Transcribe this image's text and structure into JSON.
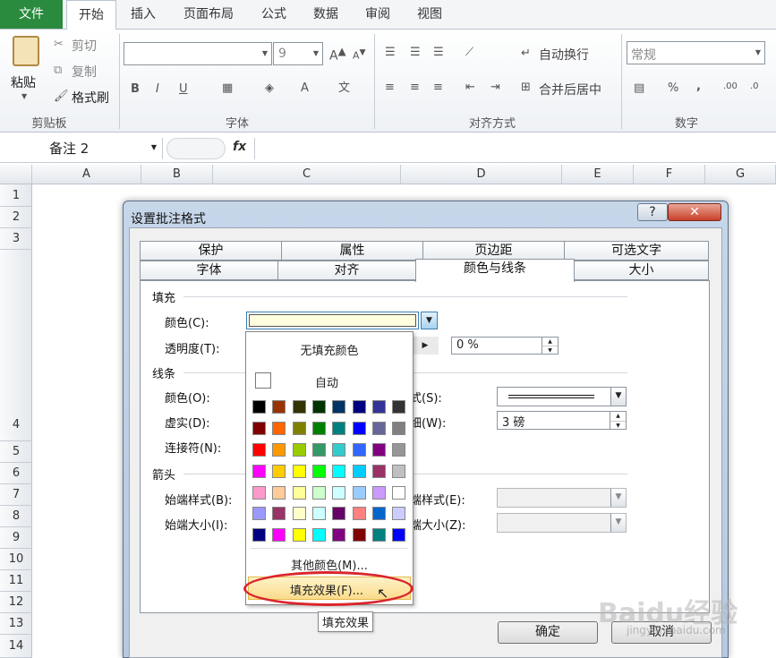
{
  "ribbon": {
    "tabs": [
      "文件",
      "开始",
      "插入",
      "页面布局",
      "公式",
      "数据",
      "审阅",
      "视图"
    ],
    "clipboard": {
      "paste": "粘贴",
      "cut": "剪切",
      "copy": "复制",
      "format_painter": "格式刷",
      "group": "剪贴板"
    },
    "font": {
      "name_value": "",
      "size_value": "9",
      "group": "字体"
    },
    "alignment": {
      "wrap": "自动换行",
      "merge": "合并后居中",
      "group": "对齐方式"
    },
    "number": {
      "format": "常规",
      "group": "数字",
      "percent": "%",
      "comma": ","
    }
  },
  "formula_bar": {
    "name_box": "备注 2",
    "fx": "fx",
    "formula": ""
  },
  "sheet": {
    "columns": [
      "A",
      "B",
      "C",
      "D",
      "E",
      "F",
      "G"
    ],
    "rows": [
      "1",
      "2",
      "3",
      "4",
      "5",
      "6",
      "7",
      "8",
      "9",
      "10",
      "11",
      "12",
      "13",
      "14"
    ]
  },
  "dialog": {
    "title": "设置批注格式",
    "help": "?",
    "close": "✕",
    "tabs_row1": [
      "保护",
      "属性",
      "页边距",
      "可选文字"
    ],
    "tabs_row2": [
      "字体",
      "对齐",
      "颜色与线条",
      "大小"
    ],
    "fill_section": "填充",
    "color_label": "颜色(C):",
    "transparency_label": "透明度(T):",
    "transparency_value": "0 %",
    "line_section": "线条",
    "line_color_label": "颜色(O):",
    "dash_label": "虚实(D):",
    "connector_label": "连接符(N):",
    "style_label": "式(S):",
    "weight_label": "细(W):",
    "weight_value": "3 磅",
    "arrow_section": "箭头",
    "begin_style_label": "始端样式(B):",
    "begin_size_label": "始端大小(I):",
    "end_style_label": "端样式(E):",
    "end_size_label": "端大小(Z):",
    "ok": "确定",
    "cancel": "取消"
  },
  "color_popup": {
    "no_fill": "无填充颜色",
    "auto": "自动",
    "more_colors": "其他颜色(M)...",
    "fill_effects": "填充效果(F)...",
    "grid": [
      [
        "#000000",
        "#993300",
        "#333300",
        "#003300",
        "#003366",
        "#000080",
        "#333399",
        "#333333"
      ],
      [
        "#800000",
        "#FF6600",
        "#808000",
        "#008000",
        "#008080",
        "#0000FF",
        "#666699",
        "#808080"
      ],
      [
        "#FF0000",
        "#FF9900",
        "#99CC00",
        "#339966",
        "#33CCCC",
        "#3366FF",
        "#800080",
        "#969696"
      ],
      [
        "#FF00FF",
        "#FFCC00",
        "#FFFF00",
        "#00FF00",
        "#00FFFF",
        "#00CCFF",
        "#993366",
        "#C0C0C0"
      ],
      [
        "#FF99CC",
        "#FFCC99",
        "#FFFF99",
        "#CCFFCC",
        "#CCFFFF",
        "#99CCFF",
        "#CC99FF",
        "#FFFFFF"
      ]
    ],
    "grid2": [
      [
        "#9999FF",
        "#993366",
        "#FFFFCC",
        "#CCFFFF",
        "#660066",
        "#FF8080",
        "#0066CC",
        "#CCCCFF"
      ],
      [
        "#000080",
        "#FF00FF",
        "#FFFF00",
        "#00FFFF",
        "#800080",
        "#800000",
        "#008080",
        "#0000FF"
      ]
    ]
  },
  "tooltip": "填充效果",
  "watermark": {
    "logo": "Baidu经验",
    "url": "jingyan.baidu.com"
  },
  "colors": {
    "file_tab": "#2a8a3e",
    "accent": "#3c7fb1",
    "highlight_ring": "#d9262c"
  }
}
